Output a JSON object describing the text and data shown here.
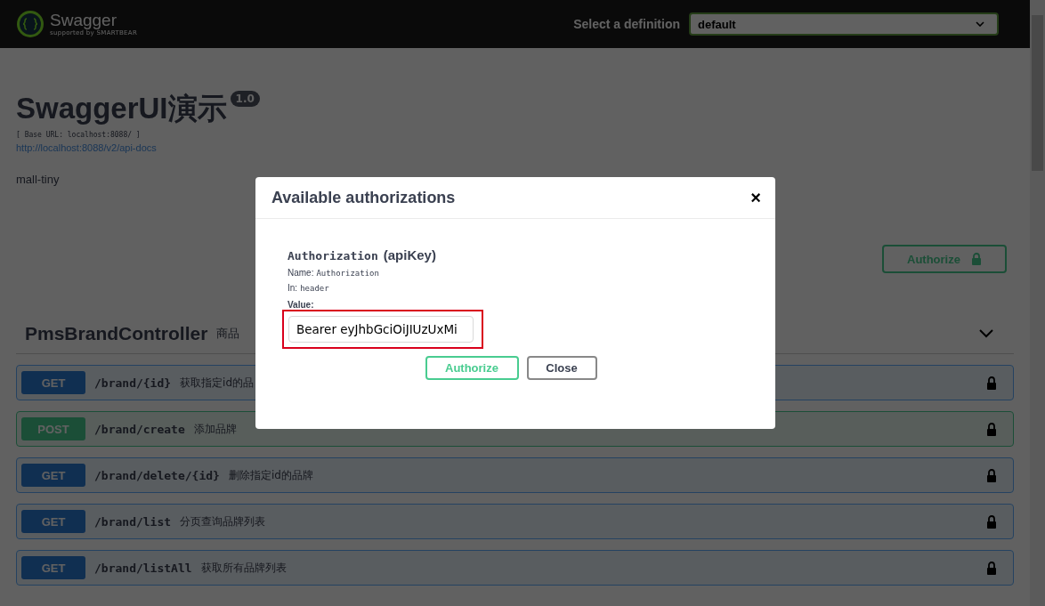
{
  "topbar": {
    "brand": "Swagger",
    "brand_sub": "supported by SMARTBEAR",
    "definition_label": "Select a definition",
    "definition_value": "default"
  },
  "info": {
    "title": "SwaggerUI演示",
    "version": "1.0",
    "base_url": "[ Base URL: localhost:8088/ ]",
    "docs_link": "http://localhost:8088/v2/api-docs",
    "description": "mall-tiny"
  },
  "authorize_button": "Authorize",
  "controller": {
    "name": "PmsBrandController",
    "description": "商品",
    "expanded": true,
    "operations": [
      {
        "method": "GET",
        "path": "/brand/{id}",
        "summary": "获取指定id的品"
      },
      {
        "method": "POST",
        "path": "/brand/create",
        "summary": "添加品牌"
      },
      {
        "method": "GET",
        "path": "/brand/delete/{id}",
        "summary": "删除指定id的品牌"
      },
      {
        "method": "GET",
        "path": "/brand/list",
        "summary": "分页查询品牌列表"
      },
      {
        "method": "GET",
        "path": "/brand/listAll",
        "summary": "获取所有品牌列表"
      }
    ]
  },
  "modal": {
    "title": "Available authorizations",
    "close": "×",
    "scheme_name": "Authorization",
    "scheme_type": "(apiKey)",
    "name_label": "Name:",
    "name_value": "Authorization",
    "in_label": "In:",
    "in_value": "header",
    "value_label": "Value:",
    "value": "Bearer eyJhbGciOiJIUzUxMi",
    "buttons": [
      "Authorize",
      "Close"
    ]
  }
}
